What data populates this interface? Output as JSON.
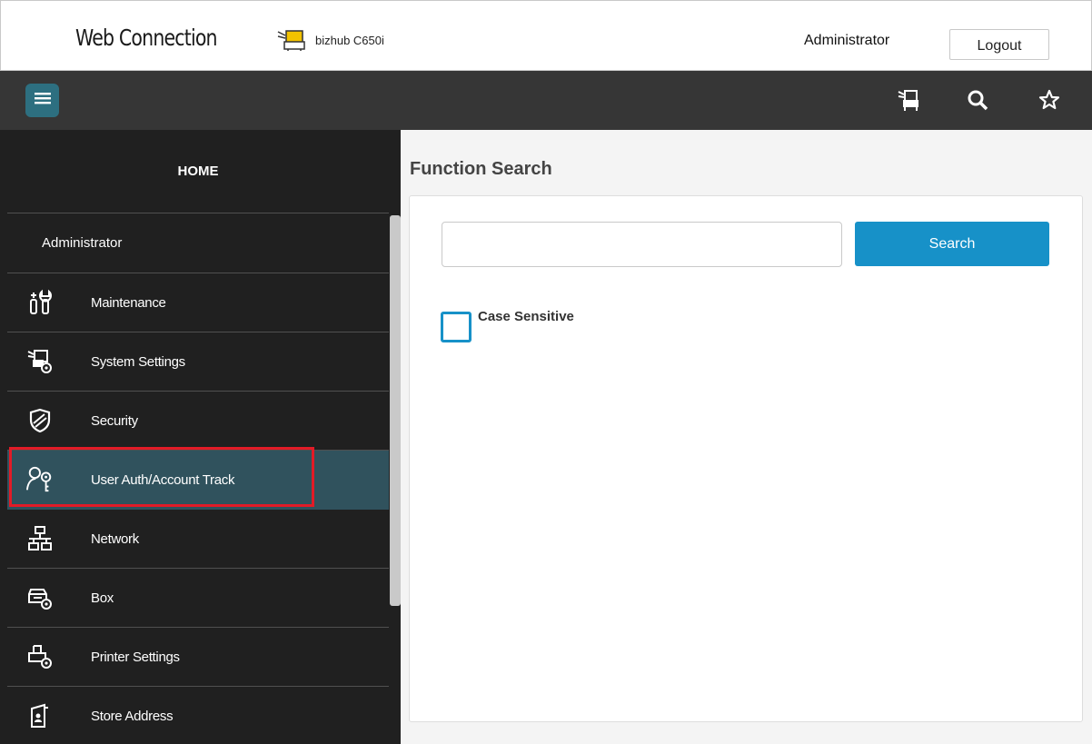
{
  "header": {
    "brand": "Web Connection",
    "model": "bizhub C650i",
    "user": "Administrator",
    "logout_label": "Logout"
  },
  "toolbar": {
    "icons": [
      "menu-icon",
      "printer-icon",
      "search-icon",
      "star-icon"
    ]
  },
  "sidebar": {
    "home_label": "HOME",
    "section_label": "Administrator",
    "items": [
      {
        "label": "Maintenance",
        "icon": "maintenance-icon"
      },
      {
        "label": "System Settings",
        "icon": "system-settings-icon"
      },
      {
        "label": "Security",
        "icon": "security-shield-icon"
      },
      {
        "label": "User Auth/Account Track",
        "icon": "user-key-icon",
        "active": true
      },
      {
        "label": "Network",
        "icon": "network-icon"
      },
      {
        "label": "Box",
        "icon": "box-icon"
      },
      {
        "label": "Printer Settings",
        "icon": "printer-settings-icon"
      },
      {
        "label": "Store Address",
        "icon": "store-address-icon"
      }
    ]
  },
  "main": {
    "title": "Function Search",
    "search": {
      "value": "",
      "placeholder": "",
      "button_label": "Search"
    },
    "case_sensitive": {
      "label": "Case Sensitive",
      "checked": false
    }
  },
  "colors": {
    "accent": "#1791c8",
    "menu_button": "#2d6f80",
    "active_item": "#30525d",
    "highlight": "#e21b27",
    "sidebar_bg": "#202020",
    "toolbar_bg": "#363636"
  }
}
